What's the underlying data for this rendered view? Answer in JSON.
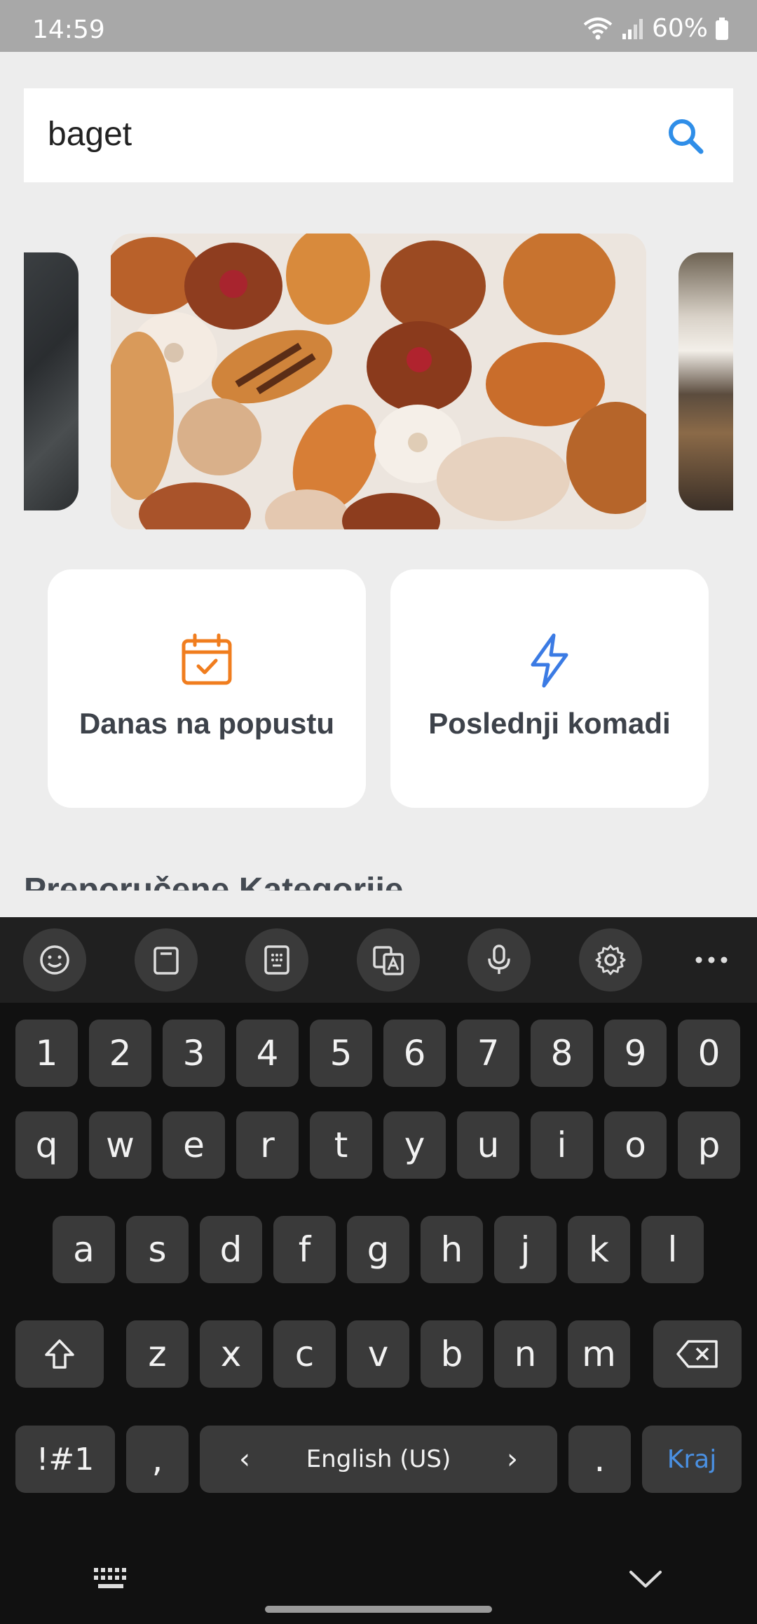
{
  "status_bar": {
    "time": "14:59",
    "battery": "60%"
  },
  "search": {
    "value": "baget"
  },
  "quick_cards": [
    {
      "label": "Danas na popustu",
      "icon": "calendar-check-icon",
      "color": "#f07d1e"
    },
    {
      "label": "Poslednji komadi",
      "icon": "lightning-icon",
      "color": "#3b7be4"
    }
  ],
  "section": {
    "title": "Preporučene Kategorije"
  },
  "keyboard": {
    "number_row": [
      "1",
      "2",
      "3",
      "4",
      "5",
      "6",
      "7",
      "8",
      "9",
      "0"
    ],
    "row1": [
      "q",
      "w",
      "e",
      "r",
      "t",
      "y",
      "u",
      "i",
      "o",
      "p"
    ],
    "row2": [
      "a",
      "s",
      "d",
      "f",
      "g",
      "h",
      "j",
      "k",
      "l"
    ],
    "row3": [
      "z",
      "x",
      "c",
      "v",
      "b",
      "n",
      "m"
    ],
    "symbols_label": "!#1",
    "comma": ",",
    "space_label": "English (US)",
    "period": ".",
    "done_label": "Kraj",
    "accent_color": "#4a90e2"
  }
}
